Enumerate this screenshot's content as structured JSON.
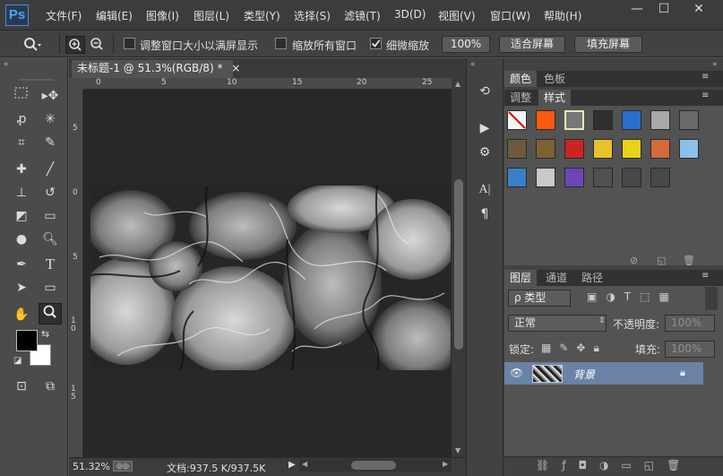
{
  "app": {
    "logo": "Ps",
    "menu": [
      "文件(F)",
      "编辑(E)",
      "图像(I)",
      "图层(L)",
      "类型(Y)",
      "选择(S)",
      "滤镜(T)",
      "3D(D)",
      "视图(V)",
      "窗口(W)",
      "帮助(H)"
    ],
    "window_controls": {
      "minimize": "—",
      "maximize": "☐",
      "close": "✕"
    }
  },
  "options": {
    "tool_icon": "zoom-icon",
    "resize_windows": "调整窗口大小以满屏显示",
    "zoom_all_windows": "缩放所有窗口",
    "scrubby_zoom": "细微缩放",
    "scrubby_zoom_checked": true,
    "percent_btn": "100%",
    "fit_screen_btn": "适合屏幕",
    "fill_screen_btn": "填充屏幕"
  },
  "document": {
    "tab_title": "未标题-1 @ 51.3%(RGB/8) *",
    "tab_close": "×",
    "ruler_top": [
      "0",
      "5",
      "10",
      "15",
      "20",
      "25"
    ],
    "ruler_left": [
      "5",
      "0",
      "5",
      "1 0",
      "1 5"
    ],
    "zoom": "51.32%",
    "doc_size": "文档:937.5 K/937.5K"
  },
  "panels": {
    "color_tab": "颜色",
    "swatches_tab": "色板",
    "adjust_tab": "调整",
    "styles_tab": "样式",
    "layers_tab": "图层",
    "channels_tab": "通道",
    "paths_tab": "路径",
    "kind_filter": "ρ 类型",
    "blend_mode": "正常",
    "opacity_label": "不透明度:",
    "opacity_value": "100%",
    "lock_label": "锁定:",
    "fill_label": "填充:",
    "fill_value": "100%",
    "layer_name": "背景",
    "style_colors": [
      "#f4f4f4",
      "#ff5a10",
      "#777777",
      "#2f2f2f",
      "#2a6fd0",
      "#a9a9a9",
      "#6a6a6a",
      "#6e5a38",
      "#7d6233",
      "#cc2424",
      "#e6c22b",
      "#e8d21c",
      "#d46a3c",
      "#8ac0ea",
      "#3b7ec8",
      "#c9c9c9",
      "#6c46b6",
      "#505050",
      "#484848",
      "#484848"
    ]
  },
  "colors": {
    "foreground": "#000000",
    "background": "#ffffff",
    "accent": "#4fa3ff",
    "selected_layer": "#6982a6"
  }
}
